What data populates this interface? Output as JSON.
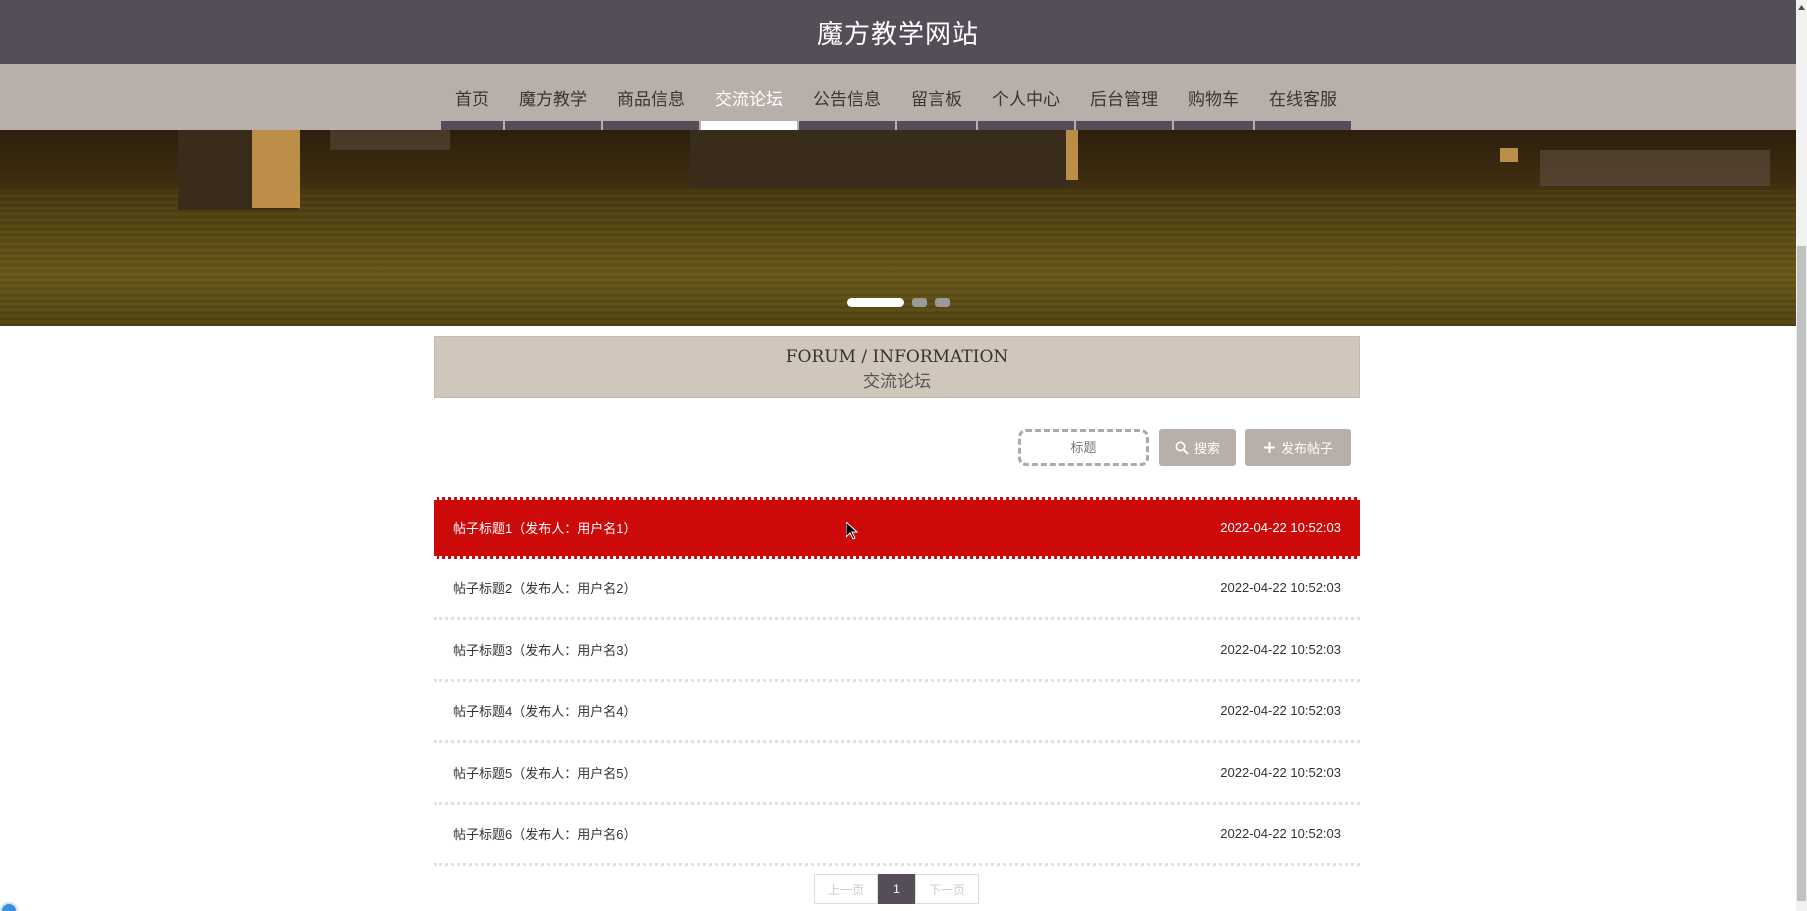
{
  "header": {
    "title": "魔方教学网站"
  },
  "nav": {
    "items": [
      {
        "label": "首页",
        "active": false
      },
      {
        "label": "魔方教学",
        "active": false
      },
      {
        "label": "商品信息",
        "active": false
      },
      {
        "label": "交流论坛",
        "active": true
      },
      {
        "label": "公告信息",
        "active": false
      },
      {
        "label": "留言板",
        "active": false
      },
      {
        "label": "个人中心",
        "active": false
      },
      {
        "label": "后台管理",
        "active": false
      },
      {
        "label": "购物车",
        "active": false
      },
      {
        "label": "在线客服",
        "active": false
      }
    ]
  },
  "banner": {
    "slides": 3,
    "active_slide": 1
  },
  "section": {
    "title_en": "FORUM / INFORMATION",
    "title_zh": "交流论坛"
  },
  "search": {
    "placeholder": "标题",
    "value": "",
    "search_label": "搜索",
    "add_label": "发布帖子"
  },
  "posts": [
    {
      "title": "帖子标题1（发布人：用户名1）",
      "time": "2022-04-22 10:52:03",
      "highlighted": true
    },
    {
      "title": "帖子标题2（发布人：用户名2）",
      "time": "2022-04-22 10:52:03",
      "highlighted": false
    },
    {
      "title": "帖子标题3（发布人：用户名3）",
      "time": "2022-04-22 10:52:03",
      "highlighted": false
    },
    {
      "title": "帖子标题4（发布人：用户名4）",
      "time": "2022-04-22 10:52:03",
      "highlighted": false
    },
    {
      "title": "帖子标题5（发布人：用户名5）",
      "time": "2022-04-22 10:52:03",
      "highlighted": false
    },
    {
      "title": "帖子标题6（发布人：用户名6）",
      "time": "2022-04-22 10:52:03",
      "highlighted": false
    }
  ],
  "pagination": {
    "prev": "上一页",
    "current": "1",
    "next": "下一页"
  },
  "colors": {
    "header_bg": "#554d58",
    "nav_bg": "#b8aeaa",
    "highlight": "#cc0a0a",
    "section_bg": "#d0c6bc"
  },
  "icons": {
    "search": "search-icon",
    "add": "plus-icon"
  }
}
